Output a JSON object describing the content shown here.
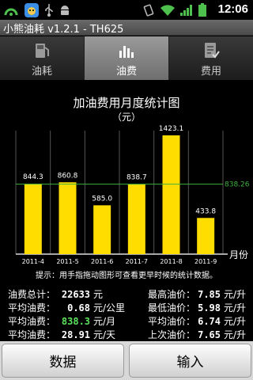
{
  "statusbar": {
    "time": "12:06",
    "icons_left": [
      "connection-icon",
      "game-app-icon",
      "usb-icon",
      "android-debug-icon"
    ],
    "icons_right": [
      "vibrate-icon",
      "wifi-icon",
      "signal-icon",
      "battery-icon"
    ]
  },
  "app": {
    "title": "小熊油耗 v1.2.1 - TH625"
  },
  "tabs": [
    {
      "label": "油耗",
      "icon": "fuel-pump-icon",
      "active": false
    },
    {
      "label": "油费",
      "icon": "bar-chart-icon",
      "active": true
    },
    {
      "label": "费用",
      "icon": "checklist-icon",
      "active": false
    }
  ],
  "chart_data": {
    "type": "bar",
    "title": "加油费用月度统计图",
    "unit_label": "（元）",
    "xlabel": "月份",
    "categories": [
      "2011-4",
      "2011-5",
      "2011-6",
      "2011-7",
      "2011-8",
      "2011-9"
    ],
    "values": [
      844.3,
      860.8,
      585.0,
      838.7,
      1423.1,
      433.8
    ],
    "value_labels": [
      "844.3",
      "860.8",
      "585.0",
      "838.7",
      "1423.1",
      "433.8"
    ],
    "average": 838.26,
    "average_label": "838.26",
    "ylim": [
      0,
      1480
    ],
    "bar_color": "#ffdd00",
    "average_line_color": "#3fb23f",
    "grid": true
  },
  "hint": "提示：用手指拖动图形可查看更早时候的统计数据。",
  "stats": {
    "left": [
      {
        "label": "油费总计：",
        "value": "22633",
        "unit": "元",
        "highlight": false
      },
      {
        "label": "平均油费：",
        "value": "0.68",
        "unit": "元/公里",
        "highlight": false
      },
      {
        "label": "平均油费：",
        "value": "838.3",
        "unit": "元/月",
        "highlight": true
      },
      {
        "label": "平均油费：",
        "value": "28.91",
        "unit": "元/天",
        "highlight": false
      }
    ],
    "right": [
      {
        "label": "最高油价：",
        "value": "7.85",
        "unit": "元/升"
      },
      {
        "label": "最低油价：",
        "value": "5.98",
        "unit": "元/升"
      },
      {
        "label": "平均油价：",
        "value": "6.74",
        "unit": "元/升"
      },
      {
        "label": "上次油价：",
        "value": "7.65",
        "unit": "元/升"
      }
    ]
  },
  "buttons": {
    "data": "数据",
    "input": "输入"
  },
  "colors": {
    "highlight_green": "#5be35b",
    "bar_yellow": "#ffdd00",
    "active_tab": "#8a8a8a"
  }
}
